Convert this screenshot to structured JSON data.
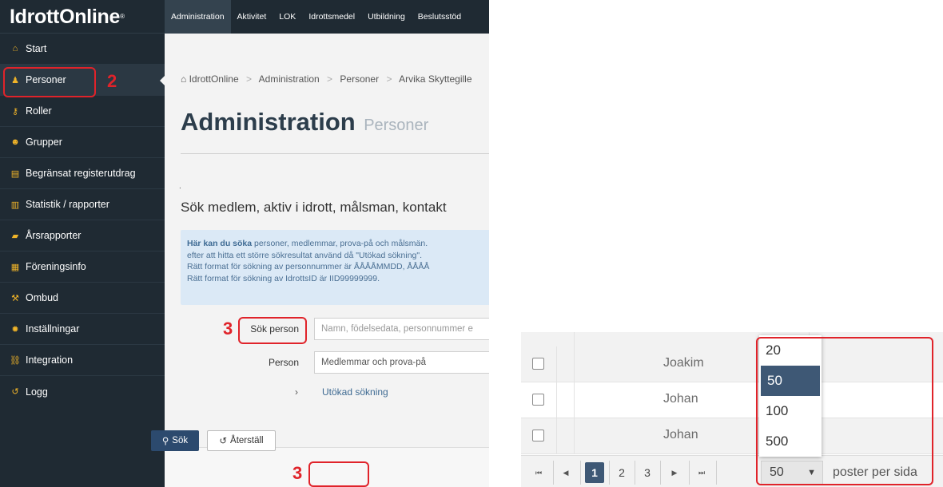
{
  "sidebar": {
    "logo": "IdrottOnline",
    "logo_mark": "®",
    "items": [
      {
        "label": "Start",
        "icon": "home-icon",
        "glyph": "⌂"
      },
      {
        "label": "Personer",
        "icon": "user-icon",
        "glyph": "♟"
      },
      {
        "label": "Roller",
        "icon": "key-icon",
        "glyph": "⚷"
      },
      {
        "label": "Grupper",
        "icon": "group-icon",
        "glyph": "☻"
      },
      {
        "label": "Begränsat registerutdrag",
        "icon": "clipboard-icon",
        "glyph": "▤"
      },
      {
        "label": "Statistik / rapporter",
        "icon": "bar-chart-icon",
        "glyph": "▥"
      },
      {
        "label": "Årsrapporter",
        "icon": "book-icon",
        "glyph": "▰"
      },
      {
        "label": "Föreningsinfo",
        "icon": "building-icon",
        "glyph": "▦"
      },
      {
        "label": "Ombud",
        "icon": "gavel-icon",
        "glyph": "⚒"
      },
      {
        "label": "Inställningar",
        "icon": "gear-icon",
        "glyph": "✹"
      },
      {
        "label": "Integration",
        "icon": "link-icon",
        "glyph": "⛓"
      },
      {
        "label": "Logg",
        "icon": "history-icon",
        "glyph": "↺"
      }
    ]
  },
  "topnav": {
    "tabs": [
      "Administration",
      "Aktivitet",
      "LOK",
      "Idrottsmedel",
      "Utbildning",
      "Beslutsstöd"
    ]
  },
  "breadcrumb": {
    "home": "IdrottOnline",
    "items": [
      "Administration",
      "Personer",
      "Arvika Skyttegille"
    ]
  },
  "page": {
    "title": "Administration",
    "subtitle": "Personer",
    "dot": ".",
    "search_heading": "Sök medlem, aktiv i idrott, målsman, kontakt"
  },
  "info": {
    "bold": "Här kan du söka",
    "line1": " personer, medlemmar, prova-på och målsmän.",
    "line2": "efter att hitta ett större sökresultat använd då \"Utökad sökning\".",
    "line3": "Rätt format för sökning av personnummer är ÅÅÅÅMMDD, ÅÅÅÅ",
    "line4": "Rätt format för sökning av IdrottsID är IID99999999."
  },
  "form": {
    "search_person_label": "Sök person",
    "search_person_placeholder": "Namn, födelsedata, personnummer e",
    "person_label": "Person",
    "person_value": "Medlemmar och prova-på",
    "advanced_chevron": "›",
    "advanced_label": "Utökad sökning"
  },
  "buttons": {
    "search": "Sök",
    "reset": "Återställ"
  },
  "annotations": {
    "two": "2",
    "three_a": "3",
    "three_b": "3"
  },
  "grid": {
    "rows": [
      {
        "name": "Joakim"
      },
      {
        "name": "Johan"
      },
      {
        "name": "Johan"
      }
    ]
  },
  "pager": {
    "first": "⏮",
    "prev": "◀",
    "pages": [
      "1",
      "2",
      "3"
    ],
    "next": "▶",
    "last": "⏭",
    "page_size": "50",
    "caret": "▼",
    "per_page_label": "poster per sida",
    "options": [
      "20",
      "50",
      "100",
      "500"
    ],
    "selected": "50"
  },
  "colors": {
    "sidebar_bg": "#1f2a33",
    "accent": "#3e5875",
    "annotation": "#e0232a",
    "info_bg": "#dbe9f6"
  }
}
